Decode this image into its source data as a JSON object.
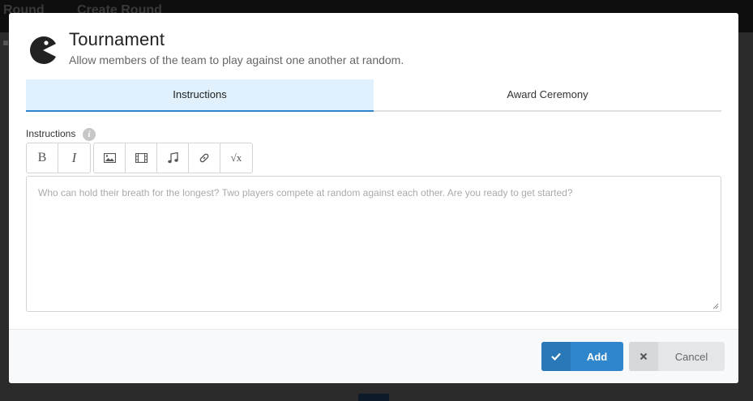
{
  "background": {
    "tabs": [
      "Round",
      "Create Round"
    ]
  },
  "modal": {
    "title": "Tournament",
    "subtitle": "Allow members of the team to play against one another at random.",
    "icon": "pacman-icon",
    "tabs": [
      {
        "label": "Instructions",
        "active": true
      },
      {
        "label": "Award Ceremony",
        "active": false
      }
    ],
    "instructions": {
      "label": "Instructions",
      "info_icon": "i",
      "placeholder": "Who can hold their breath for the longest? Two players compete at random against each other. Are you ready to get started?",
      "value": ""
    },
    "toolbar": {
      "bold": "B",
      "italic": "I",
      "sqrt": "√x",
      "icons": [
        "image-icon",
        "video-icon",
        "music-icon",
        "link-icon",
        "sqrt-icon"
      ]
    },
    "footer": {
      "add_label": "Add",
      "cancel_label": "Cancel"
    }
  },
  "colors": {
    "accent": "#2f86cc",
    "tab_active_bg": "#e0f0fc",
    "footer_bg": "#f8f9fa"
  }
}
